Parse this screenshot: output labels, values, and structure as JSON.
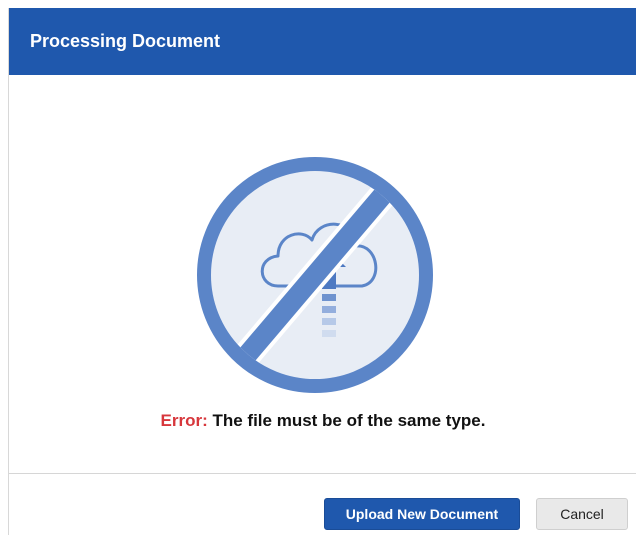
{
  "dialog": {
    "title": "Processing Document",
    "illustration_icon": "upload-prohibited-icon",
    "error_label": "Error:",
    "error_message": "The file must be of the same type.",
    "primary_button": "Upload New Document",
    "secondary_button": "Cancel"
  },
  "colors": {
    "header_background": "#1f58ad",
    "error_label": "#d7373c",
    "icon_ring": "#5b85c8",
    "icon_fill": "#e8edf5"
  }
}
